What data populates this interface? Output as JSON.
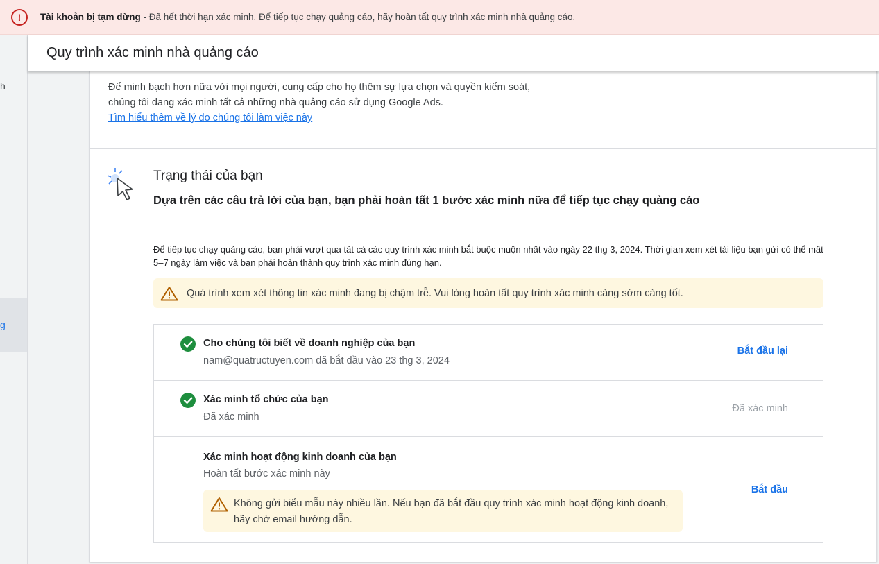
{
  "banner": {
    "title": "Tài khoản bị tạm dừng",
    "message": " - Đã hết thời hạn xác minh. Để tiếp tục chạy quảng cáo, hãy hoàn tất quy trình xác minh nhà quảng cáo.",
    "icon": "alert-circle-icon",
    "color": "#c5221f"
  },
  "leftnav": {
    "fragment_top": "h",
    "fragment_selected": "g"
  },
  "header": {
    "title": "Quy trình xác minh nhà quảng cáo"
  },
  "intro": {
    "text": "Để minh bạch hơn nữa với mọi người, cung cấp cho họ thêm sự lựa chọn và quyền kiểm soát, chúng tôi đang xác minh tất cả những nhà quảng cáo sử dụng Google Ads.",
    "link": "Tìm hiểu thêm về lý do chúng tôi làm việc này"
  },
  "status": {
    "title": "Trạng thái của bạn",
    "subtitle": "Dựa trên các câu trả lời của bạn, bạn phải hoàn tất 1 bước xác minh nữa để tiếp tục chạy quảng cáo",
    "deadline": "Để tiếp tục chạy quảng cáo, bạn phải vượt qua tất cả các quy trình xác minh bắt buộc muộn nhất vào ngày 22 thg 3, 2024. Thời gian xem xét tài liệu bạn gửi có thể mất 5–7 ngày làm việc và bạn phải hoàn thành quy trình xác minh đúng hạn.",
    "warning": "Quá trình xem xét thông tin xác minh đang bị chậm trễ. Vui lòng hoàn tất quy trình xác minh càng sớm càng tốt."
  },
  "steps": [
    {
      "title": "Cho chúng tôi biết về doanh nghiệp của bạn",
      "subtitle": "nam@quatructuyen.com đã bắt đầu vào 23 thg 3, 2024",
      "action": "Bắt đầu lại",
      "completed": true
    },
    {
      "title": "Xác minh tổ chức của bạn",
      "subtitle": "Đã xác minh",
      "action": "Đã xác minh",
      "completed": true
    },
    {
      "title": "Xác minh hoạt động kinh doanh của bạn",
      "subtitle": "Hoàn tất bước xác minh này",
      "action": "Bắt đầu",
      "completed": false,
      "warning": "Không gửi biểu mẫu này nhiều lần. Nếu bạn đã bắt đầu quy trình xác minh hoạt động kinh doanh, hãy chờ email hướng dẫn."
    }
  ],
  "colors": {
    "accent": "#1a73e8",
    "success": "#1e8e3e",
    "warning_bg": "#fef7e0",
    "warning_icon": "#b06000"
  }
}
